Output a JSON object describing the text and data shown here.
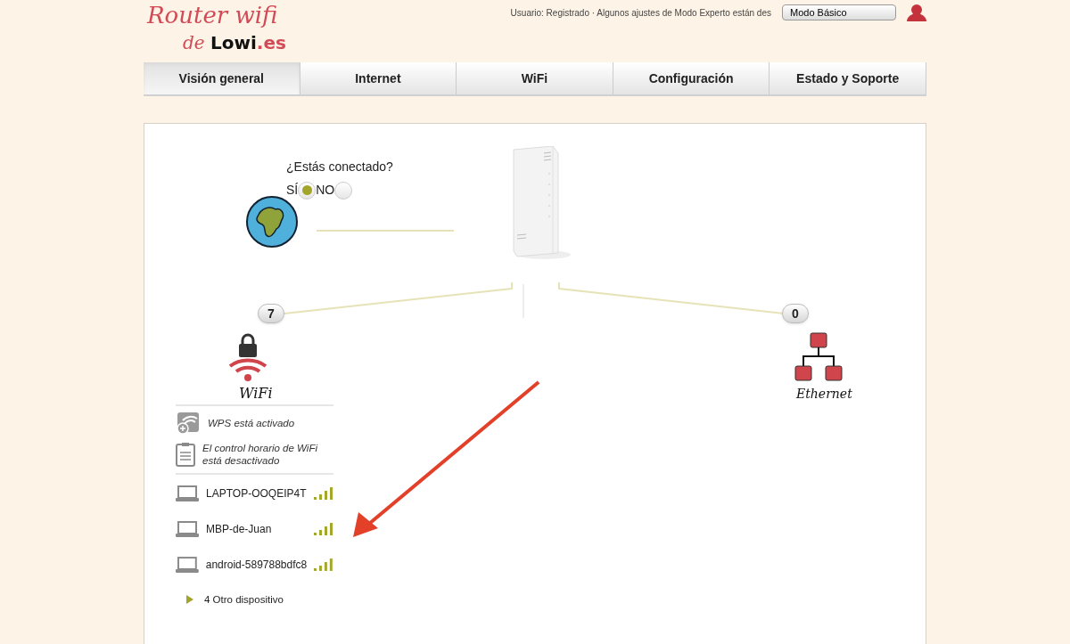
{
  "header": {
    "logo_line1": "Router wifi",
    "logo_line2_prefix": "de",
    "logo_brand": "Lowi",
    "logo_suffix": ".es",
    "user_notice": "Usuario: Registrado · Algunos ajustes de Modo Experto están des",
    "mode_select": "Modo Básico"
  },
  "tabs": [
    {
      "label": "Visión general",
      "selected": true
    },
    {
      "label": "Internet",
      "selected": false
    },
    {
      "label": "WiFi",
      "selected": false
    },
    {
      "label": "Configuración",
      "selected": false
    },
    {
      "label": "Estado y Soporte",
      "selected": false
    }
  ],
  "connection": {
    "question": "¿Estás conectado?",
    "options": [
      {
        "label": "SÍ",
        "selected": true
      },
      {
        "label": "NO",
        "selected": false
      }
    ]
  },
  "wifi": {
    "count": "7",
    "label": "WiFi",
    "features": [
      {
        "kind": "wps",
        "text": "WPS está activado"
      },
      {
        "kind": "schedule",
        "text": "El control horario de WiFi está desactivado"
      }
    ],
    "devices": [
      {
        "name": "LAPTOP-OOQEIP4T"
      },
      {
        "name": "MBP-de-Juan"
      },
      {
        "name": "android-589788bdfc8"
      }
    ],
    "more": {
      "text": "4 Otro dispositivo",
      "expanded": false
    }
  },
  "ethernet": {
    "count": "0",
    "label": "Ethernet"
  }
}
